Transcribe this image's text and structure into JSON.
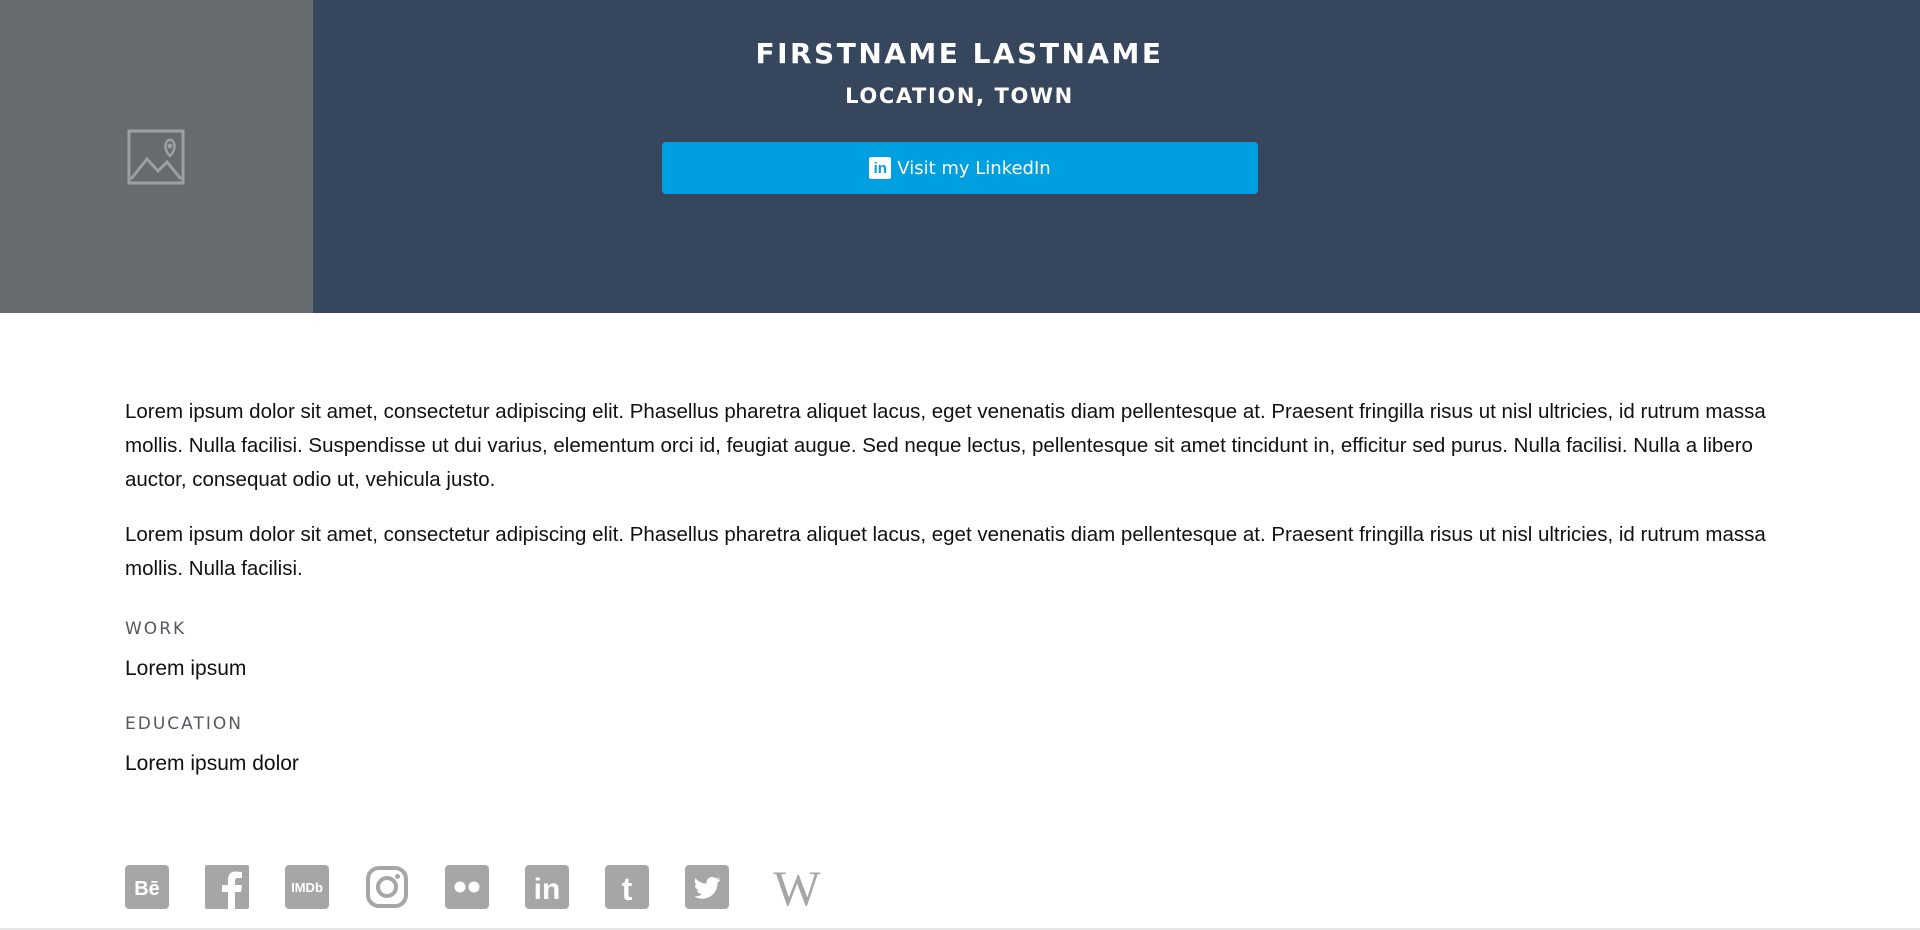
{
  "profile": {
    "name": "FIRSTNAME LASTNAME",
    "location": "LOCATION, TOWN",
    "linkedin_button": "Visit my LinkedIn",
    "linkedin_icon_text": "in"
  },
  "bio": {
    "paragraphs": [
      "Lorem ipsum dolor sit amet, consectetur adipiscing elit. Phasellus pharetra aliquet lacus, eget venenatis diam pellentesque at. Praesent fringilla risus ut nisl ultricies, id rutrum massa mollis. Nulla facilisi. Suspendisse ut dui varius, elementum orci id, feugiat augue. Sed neque lectus, pellentesque sit amet tincidunt in, efficitur sed purus. Nulla facilisi. Nulla a libero auctor, consequat odio ut, vehicula justo.",
      "Lorem ipsum dolor sit amet, consectetur adipiscing elit. Phasellus pharetra aliquet lacus, eget venenatis diam pellentesque at. Praesent fringilla risus ut nisl ultricies, id rutrum massa mollis. Nulla facilisi."
    ]
  },
  "work": {
    "label": "WORK",
    "value": "Lorem ipsum"
  },
  "education": {
    "label": "EDUCATION",
    "value": "Lorem ipsum dolor"
  },
  "social": {
    "icons": [
      "behance-icon",
      "facebook-icon",
      "imdb-icon",
      "instagram-icon",
      "flickr-icon",
      "linkedin-icon",
      "tumblr-icon",
      "twitter-icon",
      "wikipedia-icon"
    ],
    "behance_text": "Bē",
    "imdb_text": "IMDb",
    "linkedin_text": "in",
    "tumblr_text": "t",
    "wikipedia_text": "W"
  },
  "colors": {
    "header_bg": "#35465d",
    "photo_bg": "#666b70",
    "linkedin_blue": "#009fdf",
    "icon_grey": "#a6a6a6"
  }
}
